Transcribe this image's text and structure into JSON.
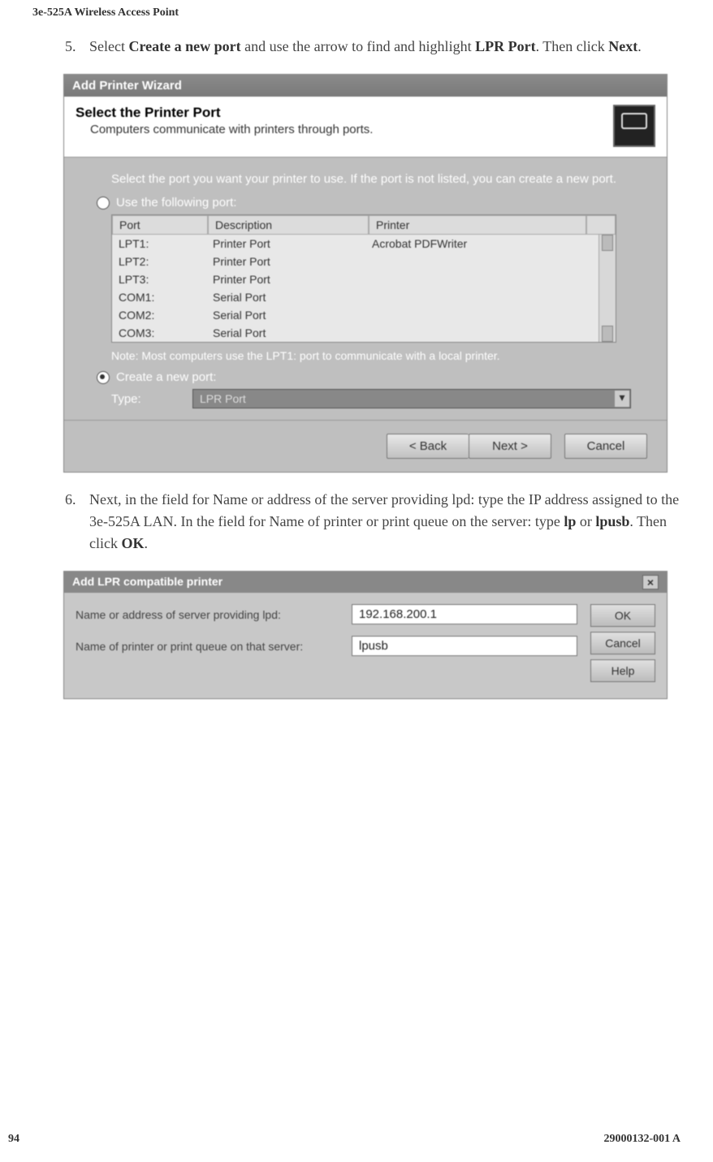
{
  "header": "3e-525A Wireless Access Point",
  "step5": {
    "num": "5.",
    "text_a": "Select ",
    "bold_a": "Create a new port",
    "text_b": " and use the arrow to find and highlight ",
    "bold_b": "LPR Port",
    "text_c": ". Then click ",
    "bold_c": "Next",
    "text_d": "."
  },
  "wizard": {
    "title": "Add Printer Wizard",
    "header_title": "Select the Printer Port",
    "header_sub": "Computers communicate with printers through ports.",
    "instruction": "Select the port you want your printer to use.  If the port is not listed, you can create a new port.",
    "radio_use": "Use the following port:",
    "cols": {
      "port": "Port",
      "desc": "Description",
      "printer": "Printer"
    },
    "rows": [
      {
        "port": "LPT1:",
        "desc": "Printer Port",
        "printer": "Acrobat PDFWriter"
      },
      {
        "port": "LPT2:",
        "desc": "Printer Port",
        "printer": ""
      },
      {
        "port": "LPT3:",
        "desc": "Printer Port",
        "printer": ""
      },
      {
        "port": "COM1:",
        "desc": "Serial Port",
        "printer": ""
      },
      {
        "port": "COM2:",
        "desc": "Serial Port",
        "printer": ""
      },
      {
        "port": "COM3:",
        "desc": "Serial Port",
        "printer": ""
      }
    ],
    "note": "Note: Most computers use the LPT1: port to communicate with a local printer.",
    "radio_create": "Create a new port:",
    "type_label": "Type:",
    "type_value": "LPR Port",
    "buttons": {
      "back": "< Back",
      "next": "Next >",
      "cancel": "Cancel"
    }
  },
  "step6": {
    "num": "6.",
    "text_a": "Next, in the field for Name or address of the server providing lpd: type the IP address assigned to the 3e-525A LAN. In the field for Name of printer or print queue on the server: type ",
    "bold_a": "lp",
    "text_b": " or ",
    "bold_b": "lpusb",
    "text_c": ". Then click ",
    "bold_c": "OK",
    "text_d": "."
  },
  "lpr": {
    "title": "Add LPR compatible printer",
    "label1": "Name or address of server providing lpd:",
    "value1": "192.168.200.1",
    "label2": "Name of printer or print queue on that server:",
    "value2": "lpusb",
    "buttons": {
      "ok": "OK",
      "cancel": "Cancel",
      "help": "Help"
    }
  },
  "footer": {
    "left": "94",
    "right": "29000132-001 A"
  }
}
